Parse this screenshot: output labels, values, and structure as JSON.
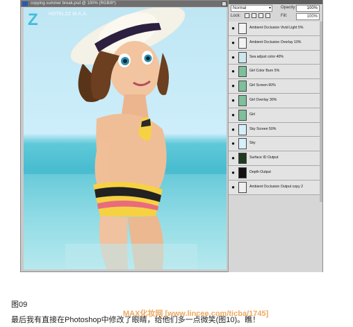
{
  "document": {
    "title": "copying summer break.psd @ 100% (RGB/8*)"
  },
  "canvas": {
    "watermark": "Z",
    "watermark_sub": "HOTELZZ  M.A.X."
  },
  "panel": {
    "blend_mode": "Normal",
    "opacity_label": "Opacity:",
    "opacity_value": "100%",
    "lock_label": "Lock:",
    "fill_label": "Fill:",
    "fill_value": "100%",
    "layers": [
      {
        "name": "Ambient Occlusion Vivid Light 5%",
        "thumb": "#f3f3f3",
        "visible": true
      },
      {
        "name": "Ambient Occlusion Overlay 10%",
        "thumb": "#f3f3f3",
        "visible": true
      },
      {
        "name": "Sea adjust color 40%",
        "thumb": "#cde7ef",
        "visible": true
      },
      {
        "name": "Girl Color Burn 5%",
        "thumb": "#7fbf9a",
        "visible": true
      },
      {
        "name": "Girl Screen 60%",
        "thumb": "#7fbf9a",
        "visible": true
      },
      {
        "name": "Girl Overlay 30%",
        "thumb": "#7fbf9a",
        "visible": true
      },
      {
        "name": "Girl",
        "thumb": "#7fbf9a",
        "visible": true
      },
      {
        "name": "Sky Screen 50%",
        "thumb": "#d4f0fb",
        "visible": true
      },
      {
        "name": "Sky",
        "thumb": "#d4f0fb",
        "visible": true
      },
      {
        "name": "Surface ID Output",
        "thumb": "#1f3a1f",
        "visible": true
      },
      {
        "name": "Depth Output",
        "thumb": "#111111",
        "visible": true
      },
      {
        "name": "Ambient Occlusion Output copy 2",
        "thumb": "#eeeeee",
        "visible": true
      }
    ]
  },
  "caption": {
    "figure": "图09",
    "text": "最后我有直接在Photoshop中修改了眼睛，给他们多一点微笑(图10)。瞧！",
    "site_watermark": "MAX化妆网 [www.lincee.com/ticba/1745]"
  }
}
